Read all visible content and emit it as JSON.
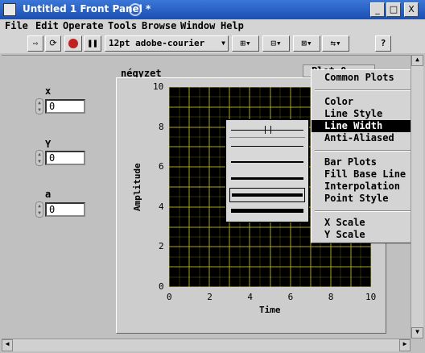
{
  "window": {
    "title": "Untitled 1 Front Panel *",
    "controls": [
      "_",
      "□",
      "X"
    ]
  },
  "menubar": [
    "File",
    "Edit",
    "Operate",
    "Tools",
    "Browse",
    "Window",
    "Help"
  ],
  "toolbar": {
    "font_select": "12pt adobe-courier",
    "help_label": "?",
    "vi_icon_number": "1"
  },
  "controls": [
    {
      "label": "x",
      "value": "0"
    },
    {
      "label": "Y",
      "value": "0"
    },
    {
      "label": "a",
      "value": "0"
    }
  ],
  "graph": {
    "title": "négyzet",
    "legend_label": "Plot 0",
    "xlabel": "Time",
    "ylabel": "Amplitude",
    "x_ticks": [
      "0",
      "2",
      "4",
      "6",
      "8",
      "10"
    ],
    "y_ticks": [
      "0",
      "2",
      "4",
      "6",
      "8",
      "10"
    ],
    "colors": {
      "background": "#000000",
      "grid": "#b8b820"
    }
  },
  "context_menu": {
    "items": [
      {
        "label": "Common Plots",
        "submenu": true
      },
      {
        "label": "Color",
        "submenu": true
      },
      {
        "label": "Line Style",
        "submenu": true
      },
      {
        "label": "Line Width",
        "submenu": true,
        "selected": true
      },
      {
        "label": "Anti-Aliased",
        "submenu": false
      },
      {
        "label": "Bar Plots",
        "submenu": true
      },
      {
        "label": "Fill Base Line",
        "submenu": true
      },
      {
        "label": "Interpolation",
        "submenu": true
      },
      {
        "label": "Point Style",
        "submenu": true
      },
      {
        "label": "X Scale",
        "submenu": true
      },
      {
        "label": "Y Scale",
        "submenu": true
      }
    ]
  },
  "line_width_popup": {
    "options": [
      "hairline",
      "1",
      "2",
      "3",
      "4",
      "5"
    ],
    "selected_index": 4
  }
}
